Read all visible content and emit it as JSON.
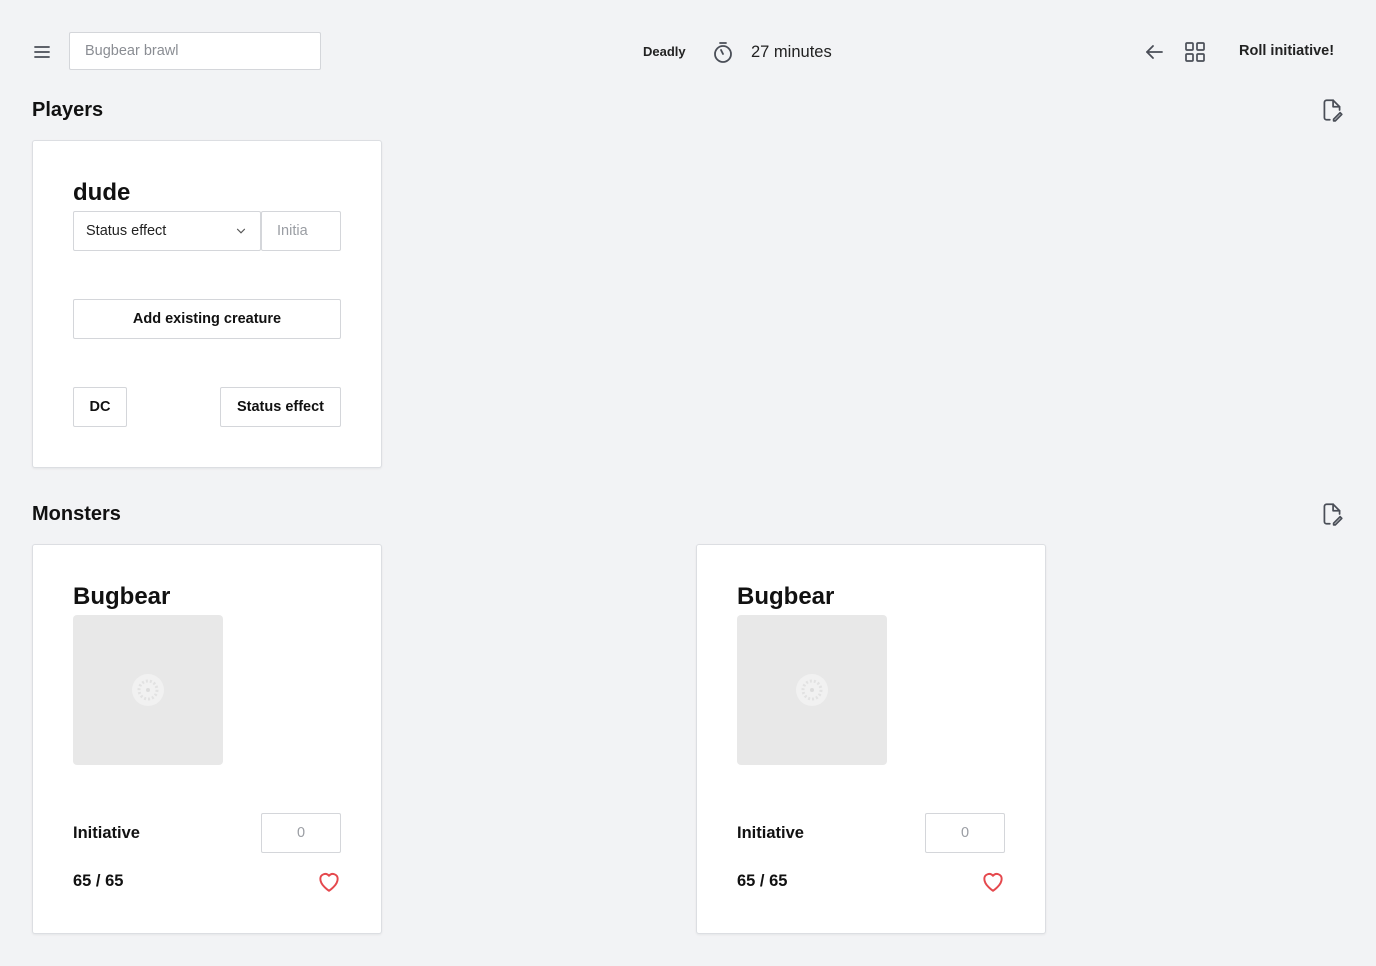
{
  "header": {
    "encounter_name_placeholder": "Bugbear brawl",
    "difficulty": "Deadly",
    "duration": "27 minutes",
    "roll_button_label": "Roll initiative!"
  },
  "players": {
    "title": "Players",
    "cards": [
      {
        "name": "dude",
        "status_select_value": "Status effect",
        "initiative_placeholder": "Initia",
        "add_existing_label": "Add existing creature",
        "dc_label": "DC",
        "status_button_label": "Status effect"
      }
    ]
  },
  "monsters": {
    "title": "Monsters",
    "cards": [
      {
        "name": "Bugbear",
        "initiative_label": "Initiative",
        "initiative_placeholder": "0",
        "hp": "65 / 65"
      },
      {
        "name": "Bugbear",
        "initiative_label": "Initiative",
        "initiative_placeholder": "0",
        "hp": "65 / 65"
      }
    ]
  },
  "colors": {
    "background": "#f2f3f5",
    "card": "#ffffff",
    "heart": "#e5484d",
    "icon": "#4a4e57"
  },
  "icons": {
    "menu": "hamburger-menu-icon",
    "timer": "stopwatch-icon",
    "back": "arrow-left-icon",
    "grid": "grid-icon",
    "document": "document-edit-icon",
    "select": "chevron-down-icon",
    "hp": "heart-icon",
    "portrait": "image-placeholder-icon"
  }
}
